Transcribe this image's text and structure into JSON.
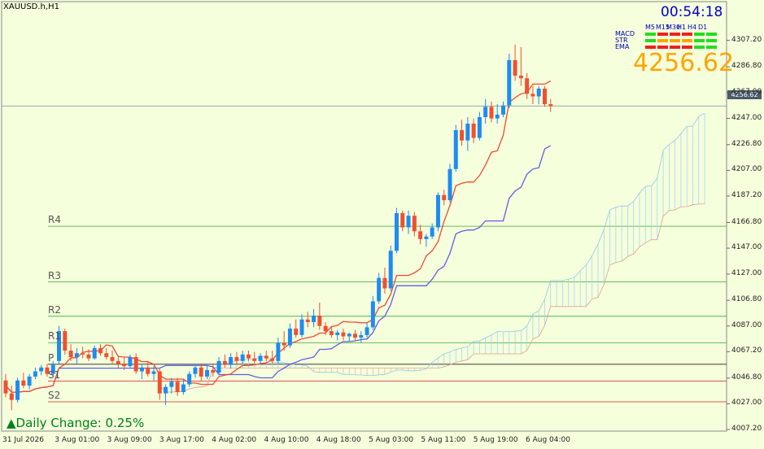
{
  "header": {
    "symbol": "XAUUSD.h,H1",
    "countdown": "00:54:18",
    "current_price": "4256.62",
    "price_label": "4256.62",
    "daily_change_arrow": "▲",
    "daily_change_label": "Daily Change:",
    "daily_change_value": "0.25%"
  },
  "indicator_panel": {
    "rows": [
      "MACD",
      "STR",
      "EMA"
    ],
    "timeframes": [
      "M5",
      "M15",
      "M30",
      "H1",
      "H4",
      "D1"
    ],
    "signals": [
      [
        "green",
        "red",
        "red",
        "red",
        "green",
        "green"
      ],
      [
        "green",
        "orange",
        "orange",
        "orange",
        "green",
        "green"
      ],
      [
        "red",
        "red",
        "red",
        "red",
        "green",
        "green"
      ]
    ]
  },
  "pivots": [
    {
      "name": "R4",
      "value": 4163.9
    },
    {
      "name": "R3",
      "value": 4121.0
    },
    {
      "name": "R2",
      "value": 4094.5
    },
    {
      "name": "R1",
      "value": 4074.0
    },
    {
      "name": "P",
      "value": 4057.5
    },
    {
      "name": "S1",
      "value": 4044.5
    },
    {
      "name": "S2",
      "value": 4028.5
    }
  ],
  "chart_data": {
    "type": "candlestick",
    "symbol": "XAUUSD.h",
    "timeframe": "H1",
    "ylim": [
      4007.2,
      4317.0
    ],
    "y_ticks": [
      "4307.20",
      "4286.80",
      "4267.00",
      "4247.00",
      "4226.80",
      "4207.00",
      "4187.20",
      "4166.80",
      "4147.00",
      "4127.00",
      "4106.80",
      "4087.00",
      "4067.20",
      "4046.80",
      "4027.00",
      "4007.20"
    ],
    "x_ticks": [
      "31 Jul 2026",
      "3 Aug 01:00",
      "3 Aug 09:00",
      "3 Aug 17:00",
      "4 Aug 02:00",
      "4 Aug 10:00",
      "4 Aug 18:00",
      "5 Aug 03:00",
      "5 Aug 11:00",
      "5 Aug 19:00",
      "6 Aug 04:00"
    ],
    "last_price": 4256.62,
    "candles": [
      [
        4045,
        4050,
        4032,
        4035
      ],
      [
        4035,
        4041,
        4022,
        4030
      ],
      [
        4030,
        4047,
        4028,
        4045
      ],
      [
        4045,
        4051,
        4039,
        4041
      ],
      [
        4041,
        4050,
        4038,
        4048
      ],
      [
        4048,
        4055,
        4046,
        4052
      ],
      [
        4052,
        4057,
        4049,
        4055
      ],
      [
        4055,
        4058,
        4048,
        4050
      ],
      [
        4050,
        4060,
        4049,
        4057
      ],
      [
        4060,
        4087,
        4058,
        4083
      ],
      [
        4083,
        4085,
        4065,
        4068
      ],
      [
        4068,
        4073,
        4060,
        4063
      ],
      [
        4063,
        4070,
        4058,
        4066
      ],
      [
        4066,
        4071,
        4062,
        4065
      ],
      [
        4065,
        4069,
        4060,
        4062
      ],
      [
        4062,
        4072,
        4061,
        4070
      ],
      [
        4070,
        4073,
        4064,
        4066
      ],
      [
        4066,
        4070,
        4061,
        4063
      ],
      [
        4063,
        4068,
        4058,
        4060
      ],
      [
        4060,
        4064,
        4054,
        4058
      ],
      [
        4058,
        4063,
        4053,
        4056
      ],
      [
        4056,
        4065,
        4055,
        4063
      ],
      [
        4063,
        4066,
        4050,
        4052
      ],
      [
        4052,
        4058,
        4046,
        4055
      ],
      [
        4055,
        4060,
        4048,
        4050
      ],
      [
        4050,
        4056,
        4045,
        4052
      ],
      [
        4052,
        4054,
        4030,
        4035
      ],
      [
        4035,
        4042,
        4026,
        4040
      ],
      [
        4040,
        4047,
        4035,
        4044
      ],
      [
        4044,
        4047,
        4033,
        4036
      ],
      [
        4036,
        4046,
        4034,
        4042
      ],
      [
        4042,
        4052,
        4040,
        4050
      ],
      [
        4050,
        4057,
        4047,
        4055
      ],
      [
        4055,
        4058,
        4045,
        4048
      ],
      [
        4048,
        4056,
        4046,
        4053
      ],
      [
        4053,
        4058,
        4048,
        4051
      ],
      [
        4051,
        4063,
        4049,
        4060
      ],
      [
        4060,
        4065,
        4055,
        4057
      ],
      [
        4057,
        4066,
        4054,
        4063
      ],
      [
        4063,
        4067,
        4057,
        4060
      ],
      [
        4060,
        4068,
        4058,
        4065
      ],
      [
        4065,
        4068,
        4060,
        4062
      ],
      [
        4062,
        4067,
        4058,
        4060
      ],
      [
        4060,
        4066,
        4058,
        4064
      ],
      [
        4064,
        4068,
        4060,
        4062
      ],
      [
        4062,
        4068,
        4058,
        4060
      ],
      [
        4060,
        4078,
        4058,
        4074
      ],
      [
        4074,
        4083,
        4068,
        4072
      ],
      [
        4072,
        4089,
        4070,
        4085
      ],
      [
        4085,
        4092,
        4078,
        4080
      ],
      [
        4080,
        4096,
        4078,
        4092
      ],
      [
        4092,
        4098,
        4086,
        4090
      ],
      [
        4090,
        4100,
        4086,
        4095
      ],
      [
        4095,
        4105,
        4084,
        4087
      ],
      [
        4087,
        4090,
        4080,
        4083
      ],
      [
        4083,
        4087,
        4078,
        4080
      ],
      [
        4080,
        4084,
        4076,
        4082
      ],
      [
        4082,
        4085,
        4076,
        4079
      ],
      [
        4079,
        4082,
        4075,
        4081
      ],
      [
        4081,
        4084,
        4076,
        4078
      ],
      [
        4078,
        4083,
        4074,
        4080
      ],
      [
        4080,
        4090,
        4078,
        4086
      ],
      [
        4086,
        4110,
        4084,
        4106
      ],
      [
        4106,
        4128,
        4104,
        4124
      ],
      [
        4124,
        4132,
        4112,
        4116
      ],
      [
        4116,
        4149,
        4114,
        4145
      ],
      [
        4145,
        4178,
        4143,
        4174
      ],
      [
        4174,
        4176,
        4160,
        4163
      ],
      [
        4163,
        4176,
        4158,
        4172
      ],
      [
        4172,
        4175,
        4156,
        4160
      ],
      [
        4160,
        4165,
        4150,
        4154
      ],
      [
        4154,
        4158,
        4148,
        4156
      ],
      [
        4156,
        4166,
        4154,
        4163
      ],
      [
        4163,
        4190,
        4160,
        4188
      ],
      [
        4188,
        4192,
        4180,
        4184
      ],
      [
        4184,
        4212,
        4182,
        4208
      ],
      [
        4208,
        4242,
        4206,
        4238
      ],
      [
        4238,
        4246,
        4226,
        4230
      ],
      [
        4230,
        4248,
        4222,
        4243
      ],
      [
        4243,
        4247,
        4228,
        4232
      ],
      [
        4232,
        4252,
        4230,
        4248
      ],
      [
        4248,
        4262,
        4243,
        4256
      ],
      [
        4256,
        4260,
        4244,
        4247
      ],
      [
        4247,
        4258,
        4243,
        4250
      ],
      [
        4250,
        4260,
        4248,
        4257
      ],
      [
        4257,
        4297,
        4255,
        4292
      ],
      [
        4292,
        4304,
        4276,
        4280
      ],
      [
        4280,
        4302,
        4272,
        4278
      ],
      [
        4278,
        4282,
        4262,
        4266
      ],
      [
        4266,
        4272,
        4258,
        4264
      ],
      [
        4264,
        4272,
        4258,
        4270
      ],
      [
        4270,
        4272,
        4256,
        4258
      ],
      [
        4258,
        4262,
        4252,
        4256.62
      ]
    ]
  }
}
